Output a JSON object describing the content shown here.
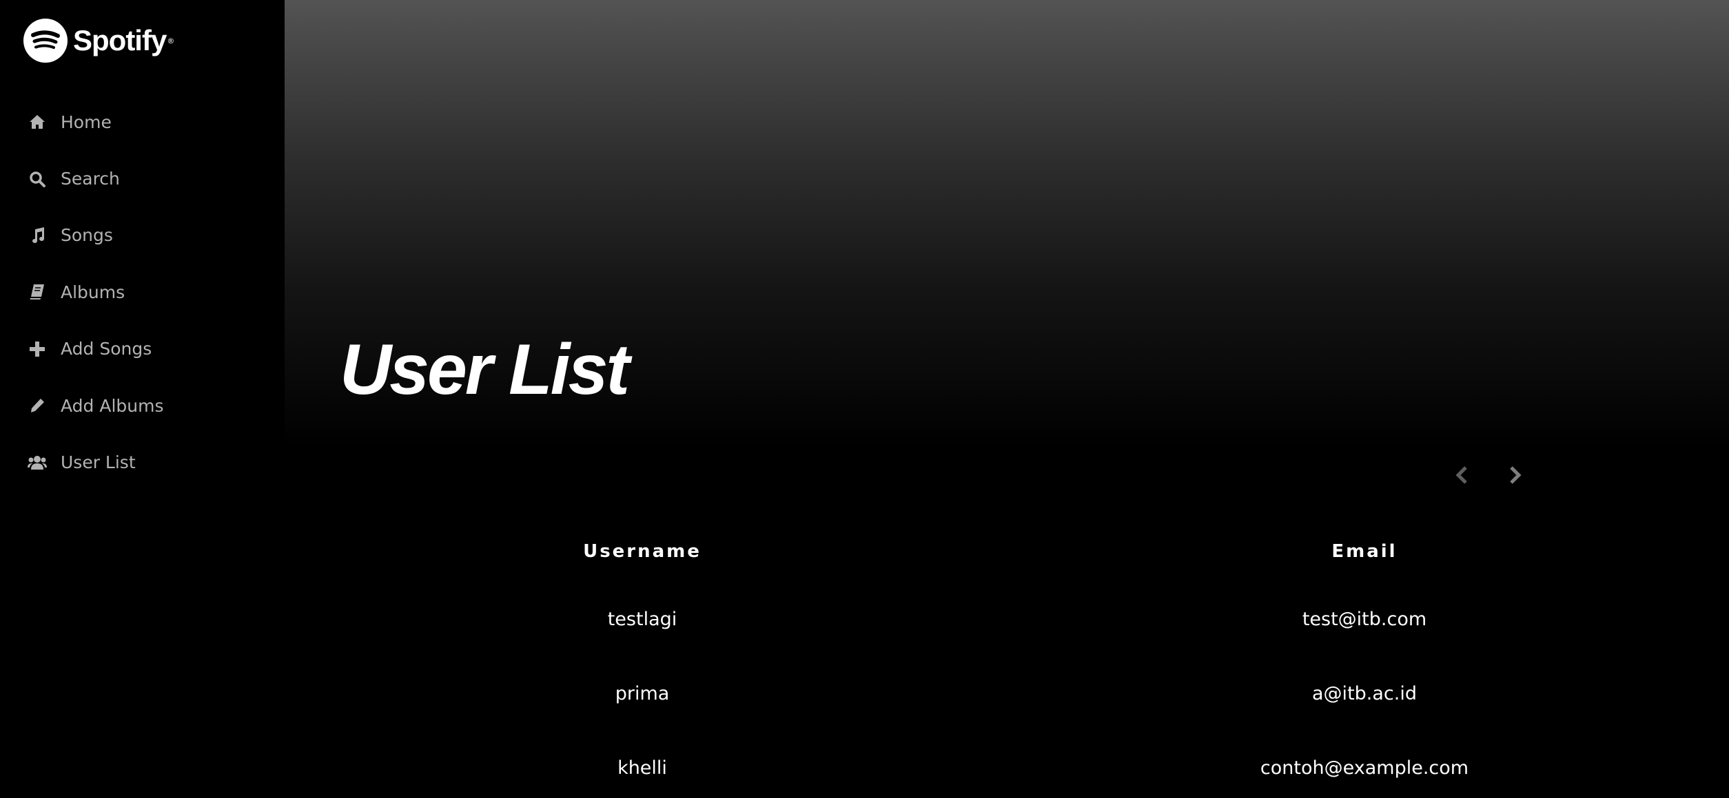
{
  "brand": {
    "name": "Spotify",
    "reg": "®"
  },
  "sidebar": {
    "items": [
      {
        "label": "Home",
        "icon": "home-icon"
      },
      {
        "label": "Search",
        "icon": "search-icon"
      },
      {
        "label": "Songs",
        "icon": "music-note-icon"
      },
      {
        "label": "Albums",
        "icon": "book-icon"
      },
      {
        "label": "Add Songs",
        "icon": "plus-icon"
      },
      {
        "label": "Add Albums",
        "icon": "pencil-icon"
      },
      {
        "label": "User List",
        "icon": "users-icon"
      }
    ]
  },
  "main": {
    "title": "User List",
    "pager": {
      "prev_icon": "chevron-left-icon",
      "next_icon": "chevron-right-icon"
    },
    "table": {
      "columns": [
        "Username",
        "Email"
      ],
      "rows": [
        {
          "username": "testlagi",
          "email": "test@itb.com"
        },
        {
          "username": "prima",
          "email": "a@itb.ac.id"
        },
        {
          "username": "khelli",
          "email": "contoh@example.com"
        }
      ]
    }
  },
  "colors": {
    "background": "#000000",
    "sidebar_text": "#b3b3b3",
    "hero_top": "#545354",
    "text": "#ffffff"
  }
}
